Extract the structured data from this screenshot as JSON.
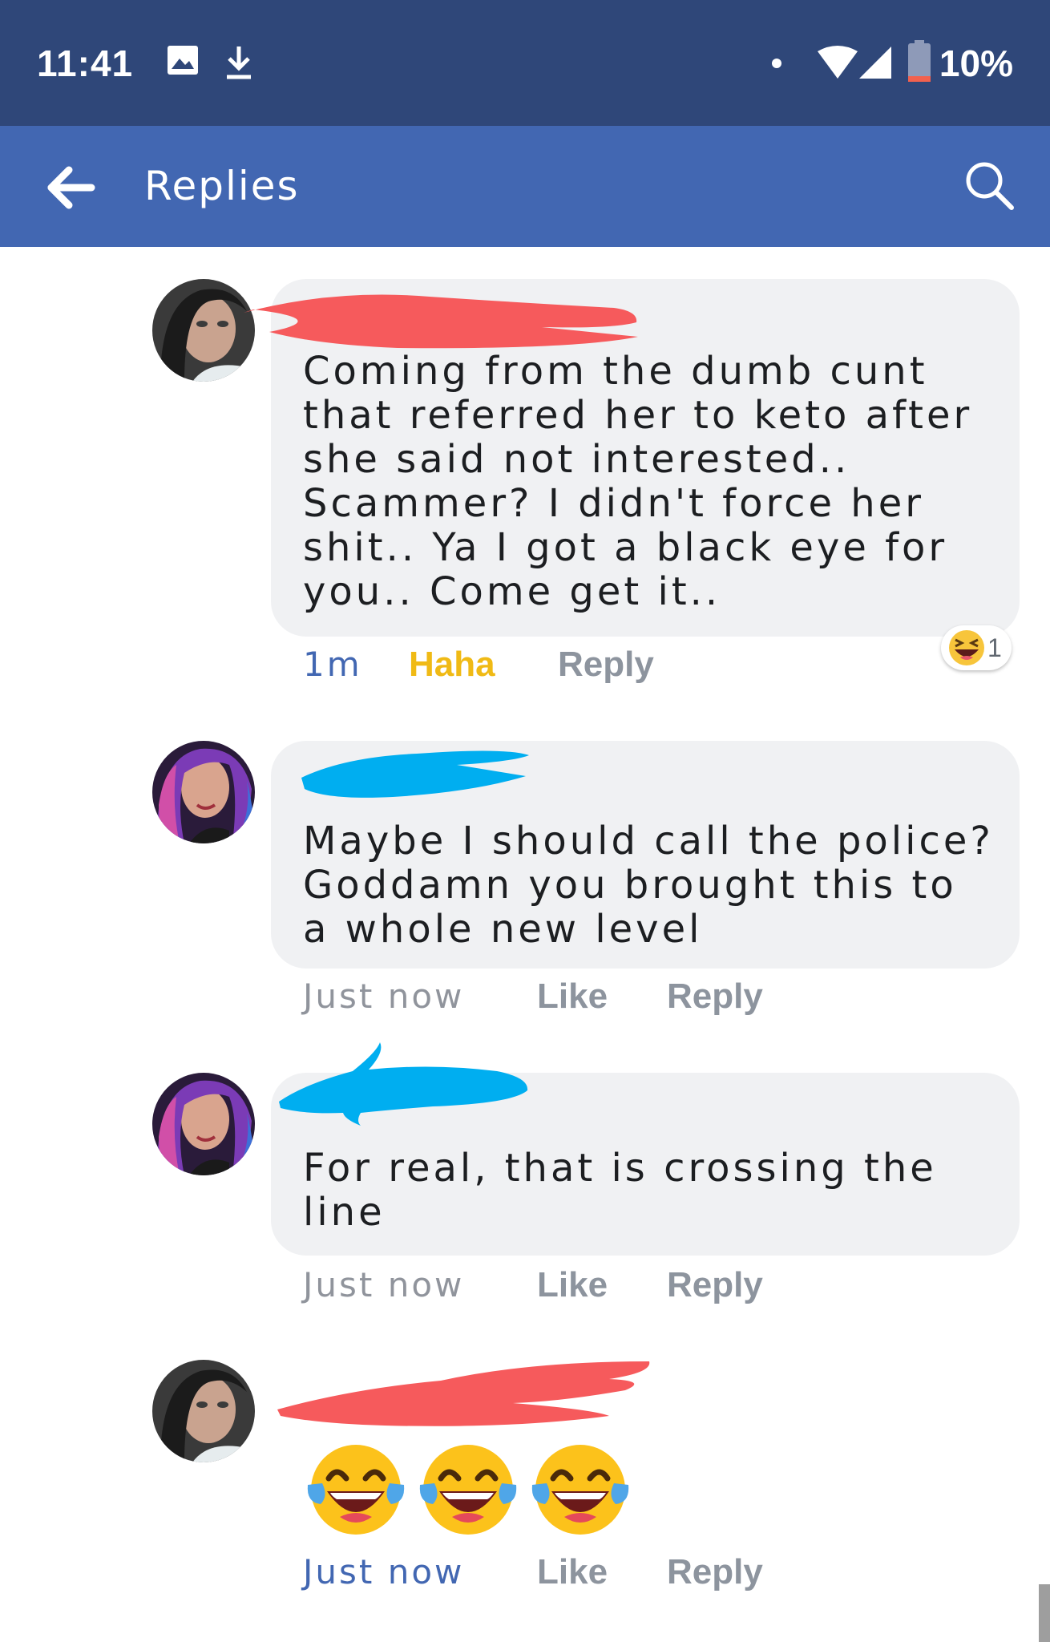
{
  "status_bar": {
    "time": "11:41",
    "battery": "10%",
    "icons": [
      "image-icon",
      "download-icon",
      "dot-icon",
      "wifi-icon",
      "signal-icon",
      "battery-icon"
    ]
  },
  "app_bar": {
    "title": "Replies",
    "back_icon": "back-arrow-icon",
    "search_icon": "search-icon"
  },
  "colors": {
    "status_bar": "#2f4779",
    "app_bar": "#4267b2",
    "bubble": "#f0f1f3",
    "haha": "#f0ba15",
    "link_blue": "#4267b2",
    "redact_red": "#f65a5c",
    "redact_blue": "#00aef0"
  },
  "comments": [
    {
      "lines": [
        "Coming from the dumb cunt",
        "that referred her to keto after",
        "she said not interested..",
        "Scammer? I didn't force her",
        "shit.. Ya I got a black eye for",
        "you.. Come get it.."
      ],
      "time": "1m",
      "reaction_label": "Haha",
      "reply_label": "Reply",
      "reaction_count": "1"
    },
    {
      "lines": [
        "Maybe I should call the police?",
        "Goddamn you brought this to",
        "a whole new level"
      ],
      "time": "Just now",
      "like_label": "Like",
      "reply_label": "Reply"
    },
    {
      "lines": [
        "For real, that is crossing the",
        "line"
      ],
      "time": "Just now",
      "like_label": "Like",
      "reply_label": "Reply"
    },
    {
      "emoji": "😂😂😂",
      "time": "Just now",
      "like_label": "Like",
      "reply_label": "Reply"
    }
  ]
}
